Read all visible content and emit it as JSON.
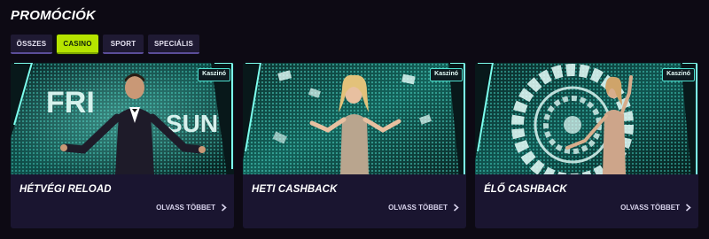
{
  "page": {
    "title": "PROMÓCIÓK"
  },
  "filters": [
    {
      "label": "ÖSSZES",
      "active": false
    },
    {
      "label": "CASINO",
      "active": true
    },
    {
      "label": "SPORT",
      "active": false
    },
    {
      "label": "SPECIÁLIS",
      "active": false
    }
  ],
  "promotions": [
    {
      "badge": "Kaszinó",
      "title": "HÉTVÉGI RELOAD",
      "link_label": "OLVASS TÖBBET",
      "image_words": [
        "FRI",
        "SUN"
      ]
    },
    {
      "badge": "Kaszinó",
      "title": "HETI CASHBACK",
      "link_label": "OLVASS TÖBBET"
    },
    {
      "badge": "Kaszinó",
      "title": "ÉLŐ CASHBACK",
      "link_label": "OLVASS TÖBBET"
    }
  ],
  "colors": {
    "background": "#0d0a14",
    "card": "#1a1530",
    "accent_active": "#b6e400",
    "badge_border": "#4ee0cf",
    "neon": "#35e6d2"
  },
  "icons": {
    "read_more": "chevron-right-icon"
  }
}
